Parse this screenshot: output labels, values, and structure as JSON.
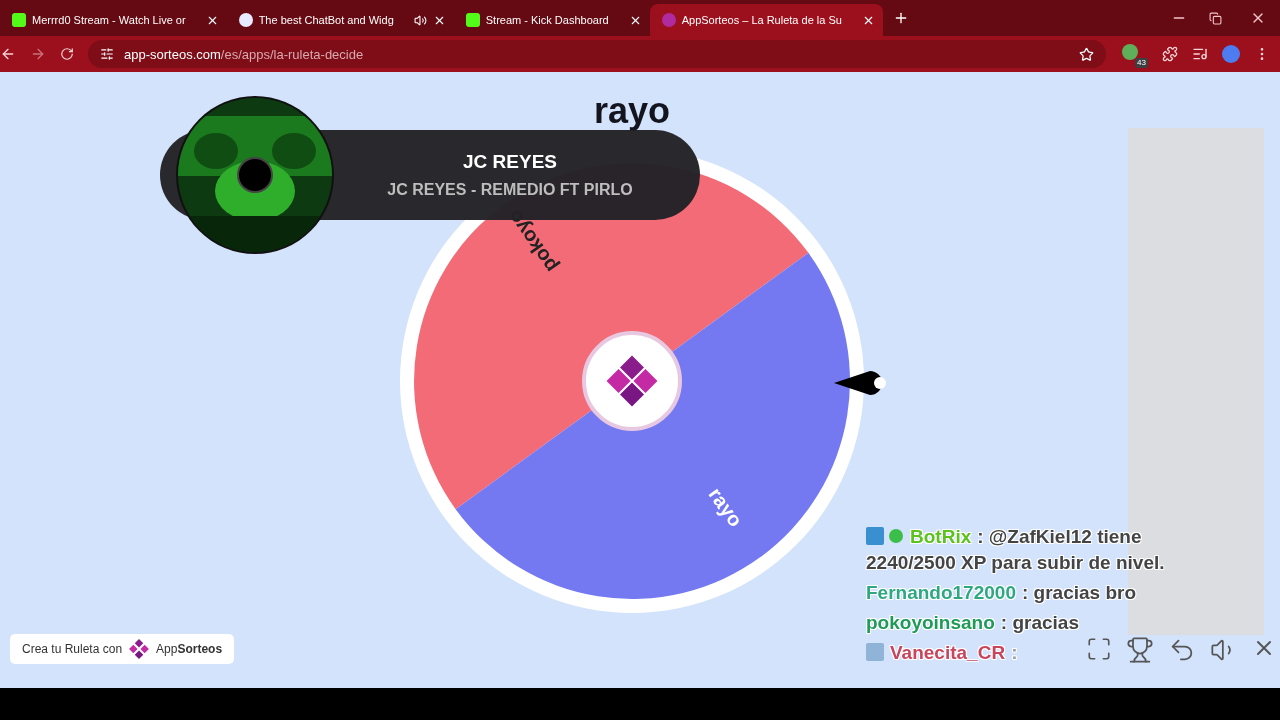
{
  "browser": {
    "tabs": [
      {
        "title": "Merrrd0 Stream - Watch Live or",
        "kind": "kick",
        "selected": false,
        "audio": false
      },
      {
        "title": "The best ChatBot and Widg",
        "kind": "bot",
        "selected": false,
        "audio": true
      },
      {
        "title": "Stream - Kick Dashboard",
        "kind": "kick",
        "selected": false,
        "audio": false
      },
      {
        "title": "AppSorteos – La Ruleta de la Su",
        "kind": "app",
        "selected": true,
        "audio": false
      }
    ],
    "url_host": "app-sorteos.com",
    "url_path": "/es/apps/la-ruleta-decide",
    "extension_badge": "43"
  },
  "page": {
    "winner": "rayo",
    "segments": [
      {
        "label": "pokoyo",
        "color": "#f26b77"
      },
      {
        "label": "rayo",
        "color": "#7479f2"
      }
    ],
    "now_playing": {
      "artist": "JC REYES",
      "track": "JC REYES - REMEDIO FT PIRLO"
    },
    "promo": {
      "text": "Crea tu Ruleta con",
      "brand_light": "App",
      "brand_bold": "Sorteos"
    }
  },
  "chat": [
    {
      "user": "BotRix",
      "color": "#5cc21e",
      "text": ": @ZafKiel12 tiene",
      "text_line_2": "2240/2500 XP para subir de nivel.",
      "badges": true,
      "faded": false
    },
    {
      "user": "Fernando172000",
      "color": "#2fa882",
      "text": ": gracias bro",
      "badges": false,
      "faded": false
    },
    {
      "user": "pokoyoinsano",
      "color": "#1f9a58",
      "text": ": gracias",
      "badges": false,
      "faded": false
    },
    {
      "user": "Vanecita_CR",
      "color": "#c8455c",
      "text": ":",
      "badges": true,
      "faded": true
    }
  ]
}
